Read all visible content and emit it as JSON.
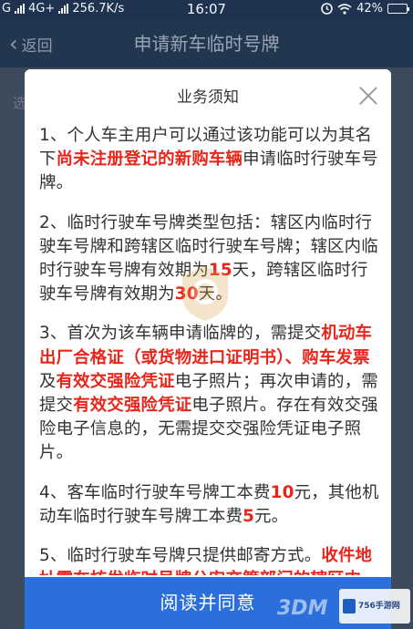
{
  "status_bar": {
    "carrier_g": "G",
    "network": "4G+",
    "speed": "256.7K/s",
    "time": "16:07",
    "battery": "42%",
    "battery_level": 0.42
  },
  "nav": {
    "back_label": "返回",
    "title": "申请新车临时号牌"
  },
  "dialog": {
    "title": "业务须知",
    "paragraphs": [
      [
        {
          "t": "1、个人车主用户可以通过该功能可以为其名下"
        },
        {
          "t": "尚未注册登记的新购车辆",
          "hl": true
        },
        {
          "t": "申请临时行驶车号牌。"
        }
      ],
      [
        {
          "t": "2、临时行驶车号牌类型包括：辖区内临时行驶车号牌和跨辖区临时行驶车号牌；辖区内临时行驶车号牌有效期为"
        },
        {
          "t": "15",
          "hl": true
        },
        {
          "t": "天，跨辖区临时行驶车号牌有效期为"
        },
        {
          "t": "30",
          "hl": true
        },
        {
          "t": "天。"
        }
      ],
      [
        {
          "t": "3、首次为该车辆申请临牌的，需提交"
        },
        {
          "t": "机动车出厂合格证（或货物进口证明书）、购车发票",
          "hl": true
        },
        {
          "t": "及"
        },
        {
          "t": "有效交强险凭证",
          "hl": true
        },
        {
          "t": "电子照片；再次申请的，需提交"
        },
        {
          "t": "有效交强险凭证",
          "hl": true
        },
        {
          "t": "电子照片。存在有效交强险电子信息的，无需提交交强险凭证电子照片。"
        }
      ],
      [
        {
          "t": "4、客车临时行驶车号牌工本费"
        },
        {
          "t": "10",
          "hl": true
        },
        {
          "t": "元，其他机动车临时行驶车号牌工本费"
        },
        {
          "t": "5",
          "hl": true
        },
        {
          "t": "元。"
        }
      ],
      [
        {
          "t": "5、临时行驶车号牌只提供邮寄方式。"
        },
        {
          "t": "收件地址需在核发临时号牌公安交管部门的辖区内。",
          "hl": true
        }
      ]
    ],
    "confirm_label": "阅读并同意"
  },
  "watermark": {
    "site": "756手游网",
    "brand": "3DM"
  },
  "colors": {
    "highlight": "#e8261b",
    "button": "#2a6fdb",
    "navbar": "#223650"
  }
}
